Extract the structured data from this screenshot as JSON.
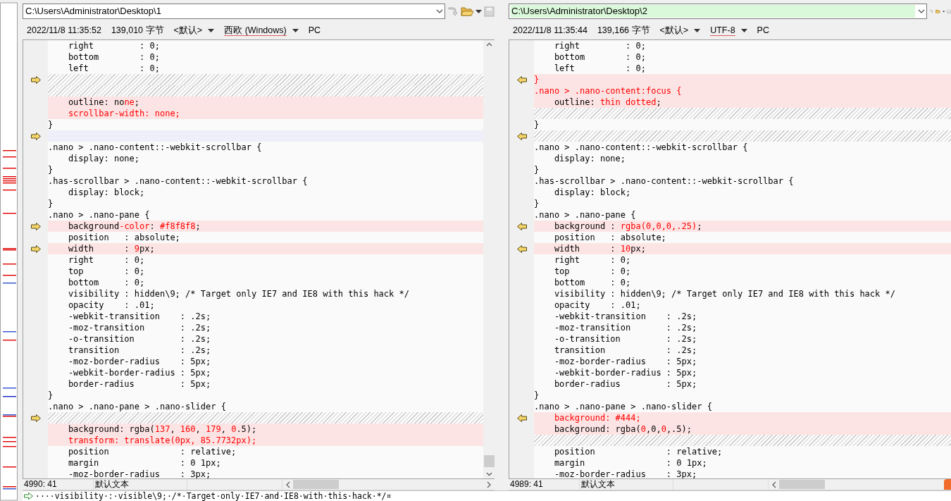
{
  "panes": [
    {
      "path": "C:\\Users\\Administrator\\Desktop\\1",
      "active": false,
      "arrow_points_left": false,
      "date": "2022/11/8 11:35:52",
      "size": "139,010 字节",
      "eol": "<默认>",
      "encoding": "西欧 (Windows)",
      "line_end": "PC",
      "position": "4990: 41",
      "syntax": "默认文本",
      "lines": [
        {
          "kind": "same",
          "parts": [
            {
              "text": "    right         : 0;",
              "diff": false
            }
          ]
        },
        {
          "kind": "same",
          "parts": [
            {
              "text": "    bottom        : 0;",
              "diff": false
            }
          ]
        },
        {
          "kind": "same",
          "parts": [
            {
              "text": "    left          : 0;",
              "diff": false
            }
          ]
        },
        {
          "kind": "blank",
          "marker": true
        },
        {
          "kind": "blank",
          "marker": false
        },
        {
          "kind": "changed",
          "marker": false,
          "parts": [
            {
              "text": "    outline: no",
              "diff": false
            },
            {
              "text": "ne",
              "diff": true
            },
            {
              "text": ";",
              "diff": false
            }
          ]
        },
        {
          "kind": "changed",
          "marker": false,
          "parts": [
            {
              "text": "    scrollbar-width: none;",
              "diff": true
            }
          ]
        },
        {
          "kind": "same",
          "parts": [
            {
              "text": "}",
              "diff": false
            }
          ]
        },
        {
          "kind": "ghost",
          "marker": true
        },
        {
          "kind": "same",
          "parts": [
            {
              "text": ".nano > .nano-content::-webkit-scrollbar {",
              "diff": false
            }
          ]
        },
        {
          "kind": "same",
          "parts": [
            {
              "text": "    display: none;",
              "diff": false
            }
          ]
        },
        {
          "kind": "same",
          "parts": [
            {
              "text": "}",
              "diff": false
            }
          ]
        },
        {
          "kind": "same",
          "parts": [
            {
              "text": ".has-scrollbar > .nano-content::-webkit-scrollbar {",
              "diff": false
            }
          ]
        },
        {
          "kind": "same",
          "parts": [
            {
              "text": "    display: block;",
              "diff": false
            }
          ]
        },
        {
          "kind": "same",
          "parts": [
            {
              "text": "}",
              "diff": false
            }
          ]
        },
        {
          "kind": "same",
          "parts": [
            {
              "text": ".nano > .nano-pane {",
              "diff": false
            }
          ]
        },
        {
          "kind": "changed",
          "marker": true,
          "parts": [
            {
              "text": "    background",
              "diff": false
            },
            {
              "text": "-color",
              "diff": true
            },
            {
              "text": ": ",
              "diff": false
            },
            {
              "text": "#f8f8f8",
              "diff": true
            },
            {
              "text": ";",
              "diff": false
            }
          ]
        },
        {
          "kind": "same",
          "parts": [
            {
              "text": "    position   : absolute;",
              "diff": false
            }
          ]
        },
        {
          "kind": "changed",
          "marker": true,
          "parts": [
            {
              "text": "    width      : ",
              "diff": false
            },
            {
              "text": "9",
              "diff": true
            },
            {
              "text": "px;",
              "diff": false
            }
          ]
        },
        {
          "kind": "same",
          "parts": [
            {
              "text": "    right      : 0;",
              "diff": false
            }
          ]
        },
        {
          "kind": "same",
          "parts": [
            {
              "text": "    top        : 0;",
              "diff": false
            }
          ]
        },
        {
          "kind": "same",
          "parts": [
            {
              "text": "    bottom     : 0;",
              "diff": false
            }
          ]
        },
        {
          "kind": "same",
          "parts": [
            {
              "text": "    visibility : hidden\\9; /* Target only IE7 and IE8 with this hack */",
              "diff": false
            }
          ]
        },
        {
          "kind": "same",
          "parts": [
            {
              "text": "    opacity    : .01;",
              "diff": false
            }
          ]
        },
        {
          "kind": "same",
          "parts": [
            {
              "text": "    -webkit-transition    : .2s;",
              "diff": false
            }
          ]
        },
        {
          "kind": "same",
          "parts": [
            {
              "text": "    -moz-transition       : .2s;",
              "diff": false
            }
          ]
        },
        {
          "kind": "same",
          "parts": [
            {
              "text": "    -o-transition         : .2s;",
              "diff": false
            }
          ]
        },
        {
          "kind": "same",
          "parts": [
            {
              "text": "    transition            : .2s;",
              "diff": false
            }
          ]
        },
        {
          "kind": "same",
          "parts": [
            {
              "text": "    -moz-border-radius    : 5px;",
              "diff": false
            }
          ]
        },
        {
          "kind": "same",
          "parts": [
            {
              "text": "    -webkit-border-radius : 5px;",
              "diff": false
            }
          ]
        },
        {
          "kind": "same",
          "parts": [
            {
              "text": "    border-radius         : 5px;",
              "diff": false
            }
          ]
        },
        {
          "kind": "same",
          "parts": [
            {
              "text": "}",
              "diff": false
            }
          ]
        },
        {
          "kind": "same",
          "parts": [
            {
              "text": ".nano > .nano-pane > .nano-slider {",
              "diff": false
            }
          ]
        },
        {
          "kind": "blank",
          "marker": true
        },
        {
          "kind": "changed",
          "marker": false,
          "parts": [
            {
              "text": "    background: rgba(",
              "diff": false
            },
            {
              "text": "137",
              "diff": true
            },
            {
              "text": ", ",
              "diff": false
            },
            {
              "text": "160",
              "diff": true
            },
            {
              "text": ", ",
              "diff": false
            },
            {
              "text": "179",
              "diff": true
            },
            {
              "text": ", ",
              "diff": false
            },
            {
              "text": "0",
              "diff": true
            },
            {
              "text": ".5);",
              "diff": false
            }
          ]
        },
        {
          "kind": "changed",
          "marker": false,
          "parts": [
            {
              "text": "    transform: translate(0px, 85.7732px);",
              "diff": true
            }
          ]
        },
        {
          "kind": "same",
          "parts": [
            {
              "text": "    position              : relative;",
              "diff": false
            }
          ]
        },
        {
          "kind": "same",
          "parts": [
            {
              "text": "    margin                : 0 1px;",
              "diff": false
            }
          ]
        },
        {
          "kind": "same",
          "parts": [
            {
              "text": "    -moz-border-radius    : 3px;",
              "diff": false
            }
          ]
        }
      ]
    },
    {
      "path": "C:\\Users\\Administrator\\Desktop\\2",
      "active": true,
      "arrow_points_left": true,
      "date": "2022/11/8 11:35:44",
      "size": "139,166 字节",
      "eol": "<默认>",
      "encoding": "UTF-8",
      "line_end": "PC",
      "position": "4989: 41",
      "syntax": "默认文本",
      "lines": [
        {
          "kind": "same",
          "parts": [
            {
              "text": "    right         : 0;",
              "diff": false
            }
          ]
        },
        {
          "kind": "same",
          "parts": [
            {
              "text": "    bottom        : 0;",
              "diff": false
            }
          ]
        },
        {
          "kind": "same",
          "parts": [
            {
              "text": "    left          : 0;",
              "diff": false
            }
          ]
        },
        {
          "kind": "changed",
          "marker": true,
          "parts": [
            {
              "text": "}",
              "diff": true
            }
          ]
        },
        {
          "kind": "changed",
          "marker": false,
          "parts": [
            {
              "text": ".nano > .nano-content:focus {",
              "diff": true
            }
          ]
        },
        {
          "kind": "changed",
          "marker": false,
          "parts": [
            {
              "text": "    outline: ",
              "diff": false
            },
            {
              "text": "thin dotted",
              "diff": true
            },
            {
              "text": ";",
              "diff": false
            }
          ]
        },
        {
          "kind": "blank",
          "marker": false
        },
        {
          "kind": "same",
          "parts": [
            {
              "text": "}",
              "diff": false
            }
          ]
        },
        {
          "kind": "blank",
          "marker": true
        },
        {
          "kind": "same",
          "parts": [
            {
              "text": ".nano > .nano-content::-webkit-scrollbar {",
              "diff": false
            }
          ]
        },
        {
          "kind": "same",
          "parts": [
            {
              "text": "    display: none;",
              "diff": false
            }
          ]
        },
        {
          "kind": "same",
          "parts": [
            {
              "text": "}",
              "diff": false
            }
          ]
        },
        {
          "kind": "same",
          "parts": [
            {
              "text": ".has-scrollbar > .nano-content::-webkit-scrollbar {",
              "diff": false
            }
          ]
        },
        {
          "kind": "same",
          "parts": [
            {
              "text": "    display: block;",
              "diff": false
            }
          ]
        },
        {
          "kind": "same",
          "parts": [
            {
              "text": "}",
              "diff": false
            }
          ]
        },
        {
          "kind": "same",
          "parts": [
            {
              "text": ".nano > .nano-pane {",
              "diff": false
            }
          ]
        },
        {
          "kind": "changed",
          "marker": true,
          "parts": [
            {
              "text": "    background : ",
              "diff": false
            },
            {
              "text": "rgba(0,0,0,.25)",
              "diff": true
            },
            {
              "text": ";",
              "diff": false
            }
          ]
        },
        {
          "kind": "same",
          "parts": [
            {
              "text": "    position   : absolute;",
              "diff": false
            }
          ]
        },
        {
          "kind": "changed",
          "marker": true,
          "parts": [
            {
              "text": "    width      : ",
              "diff": false
            },
            {
              "text": "10",
              "diff": true
            },
            {
              "text": "px;",
              "diff": false
            }
          ]
        },
        {
          "kind": "same",
          "parts": [
            {
              "text": "    right      : 0;",
              "diff": false
            }
          ]
        },
        {
          "kind": "same",
          "parts": [
            {
              "text": "    top        : 0;",
              "diff": false
            }
          ]
        },
        {
          "kind": "same",
          "parts": [
            {
              "text": "    bottom     : 0;",
              "diff": false
            }
          ]
        },
        {
          "kind": "same",
          "parts": [
            {
              "text": "    visibility : hidden\\9; /* Target only IE7 and IE8 with this hack */",
              "diff": false
            }
          ]
        },
        {
          "kind": "same",
          "parts": [
            {
              "text": "    opacity    : .01;",
              "diff": false
            }
          ]
        },
        {
          "kind": "same",
          "parts": [
            {
              "text": "    -webkit-transition    : .2s;",
              "diff": false
            }
          ]
        },
        {
          "kind": "same",
          "parts": [
            {
              "text": "    -moz-transition       : .2s;",
              "diff": false
            }
          ]
        },
        {
          "kind": "same",
          "parts": [
            {
              "text": "    -o-transition         : .2s;",
              "diff": false
            }
          ]
        },
        {
          "kind": "same",
          "parts": [
            {
              "text": "    transition            : .2s;",
              "diff": false
            }
          ]
        },
        {
          "kind": "same",
          "parts": [
            {
              "text": "    -moz-border-radius    : 5px;",
              "diff": false
            }
          ]
        },
        {
          "kind": "same",
          "parts": [
            {
              "text": "    -webkit-border-radius : 5px;",
              "diff": false
            }
          ]
        },
        {
          "kind": "same",
          "parts": [
            {
              "text": "    border-radius         : 5px;",
              "diff": false
            }
          ]
        },
        {
          "kind": "same",
          "parts": [
            {
              "text": "}",
              "diff": false
            }
          ]
        },
        {
          "kind": "same",
          "parts": [
            {
              "text": ".nano > .nano-pane > .nano-slider {",
              "diff": false
            }
          ]
        },
        {
          "kind": "changed",
          "marker": true,
          "parts": [
            {
              "text": "    background: #444;",
              "diff": true
            }
          ]
        },
        {
          "kind": "changed",
          "marker": false,
          "parts": [
            {
              "text": "    background: rgba(",
              "diff": false
            },
            {
              "text": "0",
              "diff": true
            },
            {
              "text": ",0,",
              "diff": false
            },
            {
              "text": "0",
              "diff": true
            },
            {
              "text": ",.5);",
              "diff": false
            }
          ]
        },
        {
          "kind": "blank",
          "marker": false
        },
        {
          "kind": "same",
          "parts": [
            {
              "text": "    position              : relative;",
              "diff": false
            }
          ]
        },
        {
          "kind": "same",
          "parts": [
            {
              "text": "    margin                : 0 1px;",
              "diff": false
            }
          ]
        },
        {
          "kind": "same",
          "parts": [
            {
              "text": "    -moz-border-radius    : 3px;",
              "diff": false
            }
          ]
        }
      ]
    }
  ],
  "detail_line": "····visibility·:·visible\\9;·/*·Target·only·IE7·and·IE8·with·this·hack·*/¤"
}
